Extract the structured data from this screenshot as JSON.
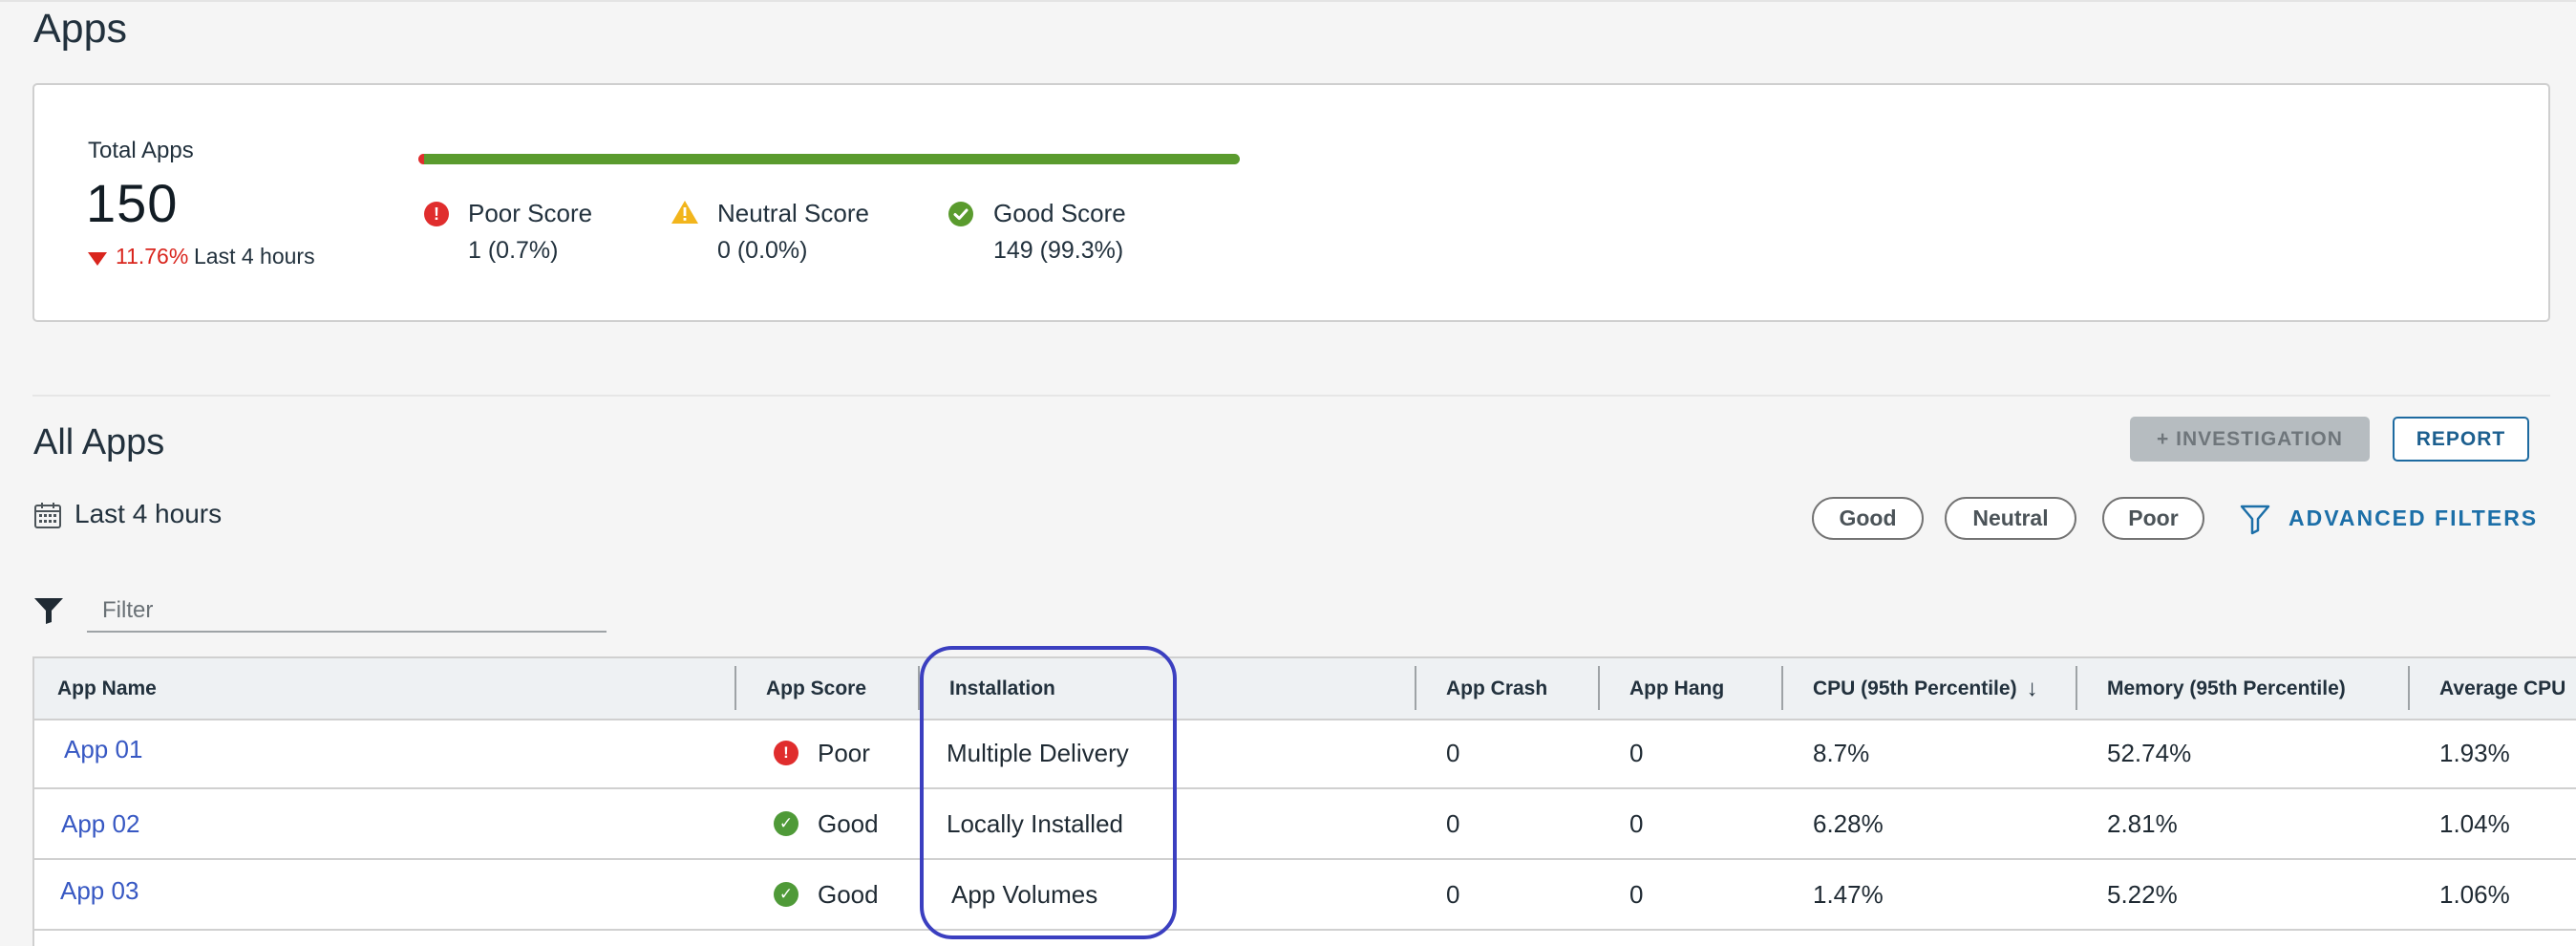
{
  "page": {
    "title": "Apps"
  },
  "summary": {
    "total_label": "Total Apps",
    "total_value": "150",
    "trend_percent": "11.76%",
    "trend_period": "Last 4 hours",
    "score_distribution": [
      {
        "key": "poor",
        "label": "Poor Score",
        "value_text": "1 (0.7%)",
        "fraction": 0.007,
        "color": "#e02d2d",
        "icon": "exclamation-circle-icon"
      },
      {
        "key": "neutral",
        "label": "Neutral Score",
        "value_text": "0 (0.0%)",
        "fraction": 0.0,
        "color": "#f2b51c",
        "icon": "warning-triangle-icon"
      },
      {
        "key": "good",
        "label": "Good Score",
        "value_text": "149 (99.3%)",
        "fraction": 0.993,
        "color": "#5a9b2e",
        "icon": "check-circle-icon"
      }
    ]
  },
  "section": {
    "title": "All Apps",
    "investigation_label": "+ INVESTIGATION",
    "report_label": "REPORT",
    "time_range": "Last 4 hours",
    "quick_filters": [
      "Good",
      "Neutral",
      "Poor"
    ],
    "advanced_filters_label": "ADVANCED FILTERS",
    "filter_placeholder": "Filter"
  },
  "table": {
    "columns": [
      "App Name",
      "App Score",
      "Installation",
      "App Crash",
      "App Hang",
      "CPU (95th Percentile)",
      "Memory (95th Percentile)",
      "Average CPU"
    ],
    "sort_icon": "sort-descending-icon",
    "rows": [
      {
        "name": "App 01",
        "score": "Poor",
        "score_color": "#e02d2d",
        "installation": "Multiple Delivery",
        "crash": "0",
        "hang": "0",
        "cpu95": "8.7%",
        "mem95": "52.74%",
        "avg_cpu": "1.93%"
      },
      {
        "name": "App 02",
        "score": "Good",
        "score_color": "#4f9a38",
        "installation": "Locally Installed",
        "crash": "0",
        "hang": "0",
        "cpu95": "6.28%",
        "mem95": "2.81%",
        "avg_cpu": "1.04%"
      },
      {
        "name": "App 03",
        "score": "Good",
        "score_color": "#4f9a38",
        "installation": "App Volumes",
        "crash": "0",
        "hang": "0",
        "cpu95": "1.47%",
        "mem95": "5.22%",
        "avg_cpu": "1.06%"
      }
    ]
  },
  "colors": {
    "link": "#3758c3",
    "accent": "#1c6fa8",
    "highlight": "#3b3fc0"
  }
}
